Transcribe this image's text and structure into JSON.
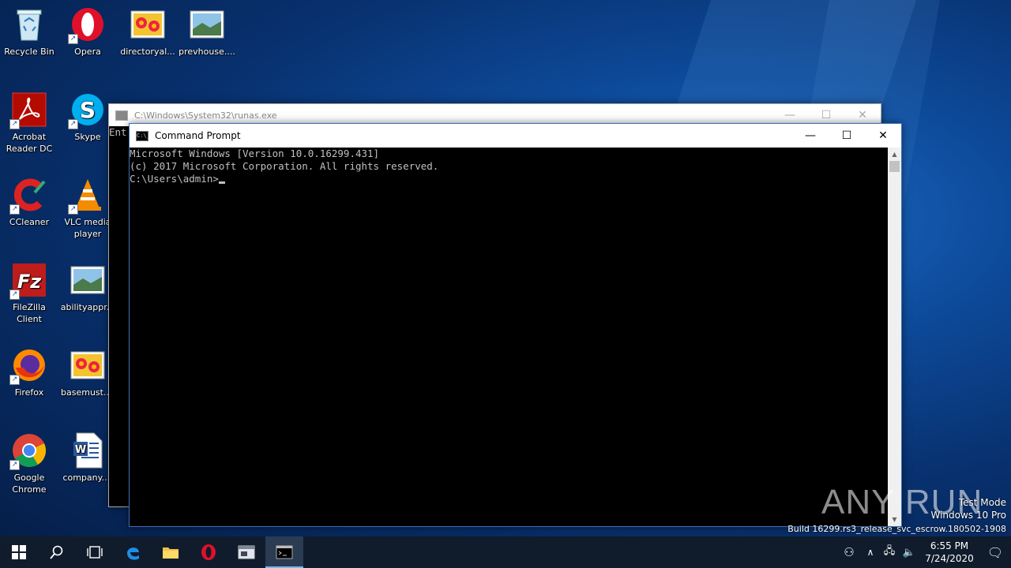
{
  "desktop": {
    "icons": [
      {
        "label": "Recycle Bin",
        "icon": "recycle-bin-icon"
      },
      {
        "label": "Opera",
        "icon": "opera-icon"
      },
      {
        "label": "directoryal...",
        "icon": "image-file-icon"
      },
      {
        "label": "prevhouse....",
        "icon": "image-file-icon"
      },
      {
        "label": "Acrobat Reader DC",
        "icon": "acrobat-icon"
      },
      {
        "label": "Skype",
        "icon": "skype-icon"
      },
      {
        "label": "CCleaner",
        "icon": "ccleaner-icon"
      },
      {
        "label": "VLC media player",
        "icon": "vlc-icon"
      },
      {
        "label": "FileZilla Client",
        "icon": "filezilla-icon"
      },
      {
        "label": "abilityappr...",
        "icon": "image-file-icon"
      },
      {
        "label": "Firefox",
        "icon": "firefox-icon"
      },
      {
        "label": "basemust....",
        "icon": "image-file-icon"
      },
      {
        "label": "Google Chrome",
        "icon": "chrome-icon"
      },
      {
        "label": "company....",
        "icon": "word-doc-icon"
      }
    ]
  },
  "runas_window": {
    "title": "C:\\Windows\\System32\\runas.exe",
    "console_text": "Ent"
  },
  "cmd_window": {
    "title": "Command Prompt",
    "console_lines": [
      "Microsoft Windows [Version 10.0.16299.431]",
      "(c) 2017 Microsoft Corporation. All rights reserved.",
      "",
      "C:\\Users\\admin>"
    ]
  },
  "watermark": {
    "line1": "Test Mode",
    "line2": "Windows 10 Pro",
    "line3": "Build 16299.rs3_release_svc_escrow.180502-1908",
    "brand": "ANY RUN"
  },
  "taskbar": {
    "time": "6:55 PM",
    "date": "7/24/2020",
    "accent": "#76b9ed"
  }
}
